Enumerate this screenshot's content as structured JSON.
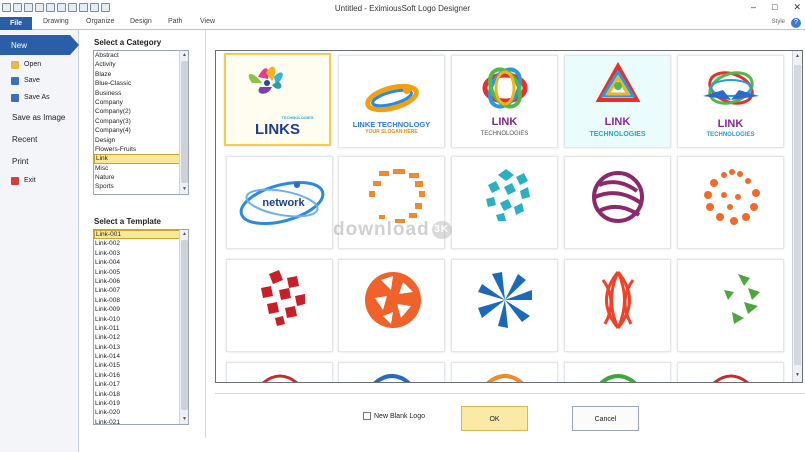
{
  "window": {
    "title": "Untitled - EximiousSoft Logo Designer",
    "controls": [
      "–",
      "□",
      "✕"
    ]
  },
  "ribbon": {
    "tabs": [
      "File",
      "Drawing",
      "Organize",
      "Design",
      "Path",
      "View"
    ],
    "style_label": "Style",
    "help_glyph": "?"
  },
  "file_menu": {
    "new": "New",
    "open": "Open",
    "save": "Save",
    "save_as": "Save As",
    "save_as_image": "Save as Image",
    "recent": "Recent",
    "print": "Print",
    "exit": "Exit"
  },
  "category": {
    "label": "Select a Category",
    "items": [
      "Abstract",
      "Activity",
      "Blaze",
      "Blue-Classic",
      "Business",
      "Company",
      "Company(2)",
      "Company(3)",
      "Company(4)",
      "Design",
      "Flowers-Fruits",
      "Link",
      "Misc",
      "Nature",
      "Sports"
    ],
    "selected": "Link"
  },
  "template": {
    "label": "Select a Template",
    "items": [
      "Link-001",
      "Link-002",
      "Link-003",
      "Link-004",
      "Link-005",
      "Link-006",
      "Link-007",
      "Link-008",
      "Link-009",
      "Link-010",
      "Link-011",
      "Link-012",
      "Link-013",
      "Link-014",
      "Link-015",
      "Link-016",
      "Link-017",
      "Link-018",
      "Link-019",
      "Link-020",
      "Link-021"
    ],
    "selected": "Link-001"
  },
  "logos": {
    "t1": {
      "name": "LINKS",
      "tag": "TECHNOLOGIES"
    },
    "t2": {
      "name": "LINKE TECHNOLOGY",
      "tag": "YOUR SLOGAN HERE"
    },
    "t3": {
      "name": "LINK",
      "tag": "TECHNOLOGIES"
    },
    "t4": {
      "name": "LINK",
      "tag": "TECHNOLOGIES"
    },
    "t5": {
      "name": "LINK",
      "tag": "TECHNOLOGIES"
    },
    "t6": {
      "name": "network"
    }
  },
  "watermark": {
    "text": "download",
    "badge": "3K"
  },
  "footer": {
    "blank_logo": "New Blank Logo",
    "ok": "OK",
    "cancel": "Cancel"
  },
  "colors": {
    "accent": "#2a5ea8",
    "selection": "#fbe79a",
    "selection_border": "#f5cd4e"
  }
}
